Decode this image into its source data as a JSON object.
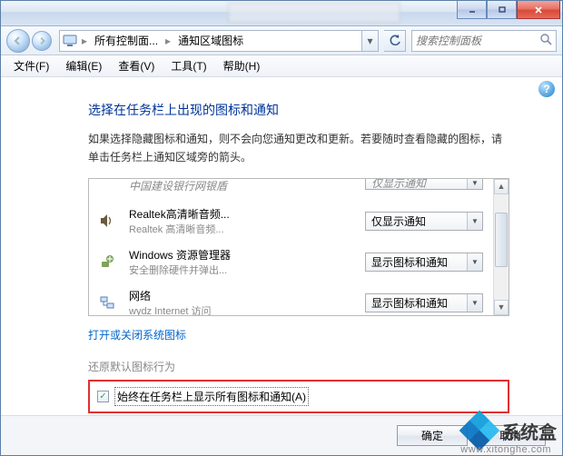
{
  "titlebar": {
    "minimize": "–",
    "maximize": "□",
    "close": "×"
  },
  "nav": {
    "breadcrumb1": "所有控制面...",
    "breadcrumb2": "通知区域图标",
    "search_placeholder": "搜索控制面板"
  },
  "menu": {
    "file": "文件(F)",
    "edit": "编辑(E)",
    "view": "查看(V)",
    "tools": "工具(T)",
    "help": "帮助(H)"
  },
  "page": {
    "title": "选择在任务栏上出现的图标和通知",
    "desc": "如果选择隐藏图标和通知，则不会向您通知更改和更新。若要随时查看隐藏的图标，请单击任务栏上通知区域旁的箭头。",
    "link_sysicons": "打开或关闭系统图标",
    "restore_label": "还原默认图标行为",
    "always_show": "始终在任务栏上显示所有图标和通知(A)"
  },
  "rows": [
    {
      "title": "中国建设银行网银盾",
      "sub": "",
      "select": "仅显示通知",
      "truncated_select": true
    },
    {
      "title": "Realtek高清晰音频...",
      "sub": "Realtek 高清晰音频...",
      "select": "仅显示通知"
    },
    {
      "title": "Windows 资源管理器",
      "sub": "安全删除硬件并弹出...",
      "select": "显示图标和通知"
    },
    {
      "title": "网络",
      "sub": "wydz Internet 访问",
      "select": "显示图标和通知",
      "cut": true
    }
  ],
  "buttons": {
    "ok": "确定",
    "cancel": "取消"
  },
  "watermark": {
    "text": "系统盒",
    "url": "www.xitonghe.com"
  }
}
